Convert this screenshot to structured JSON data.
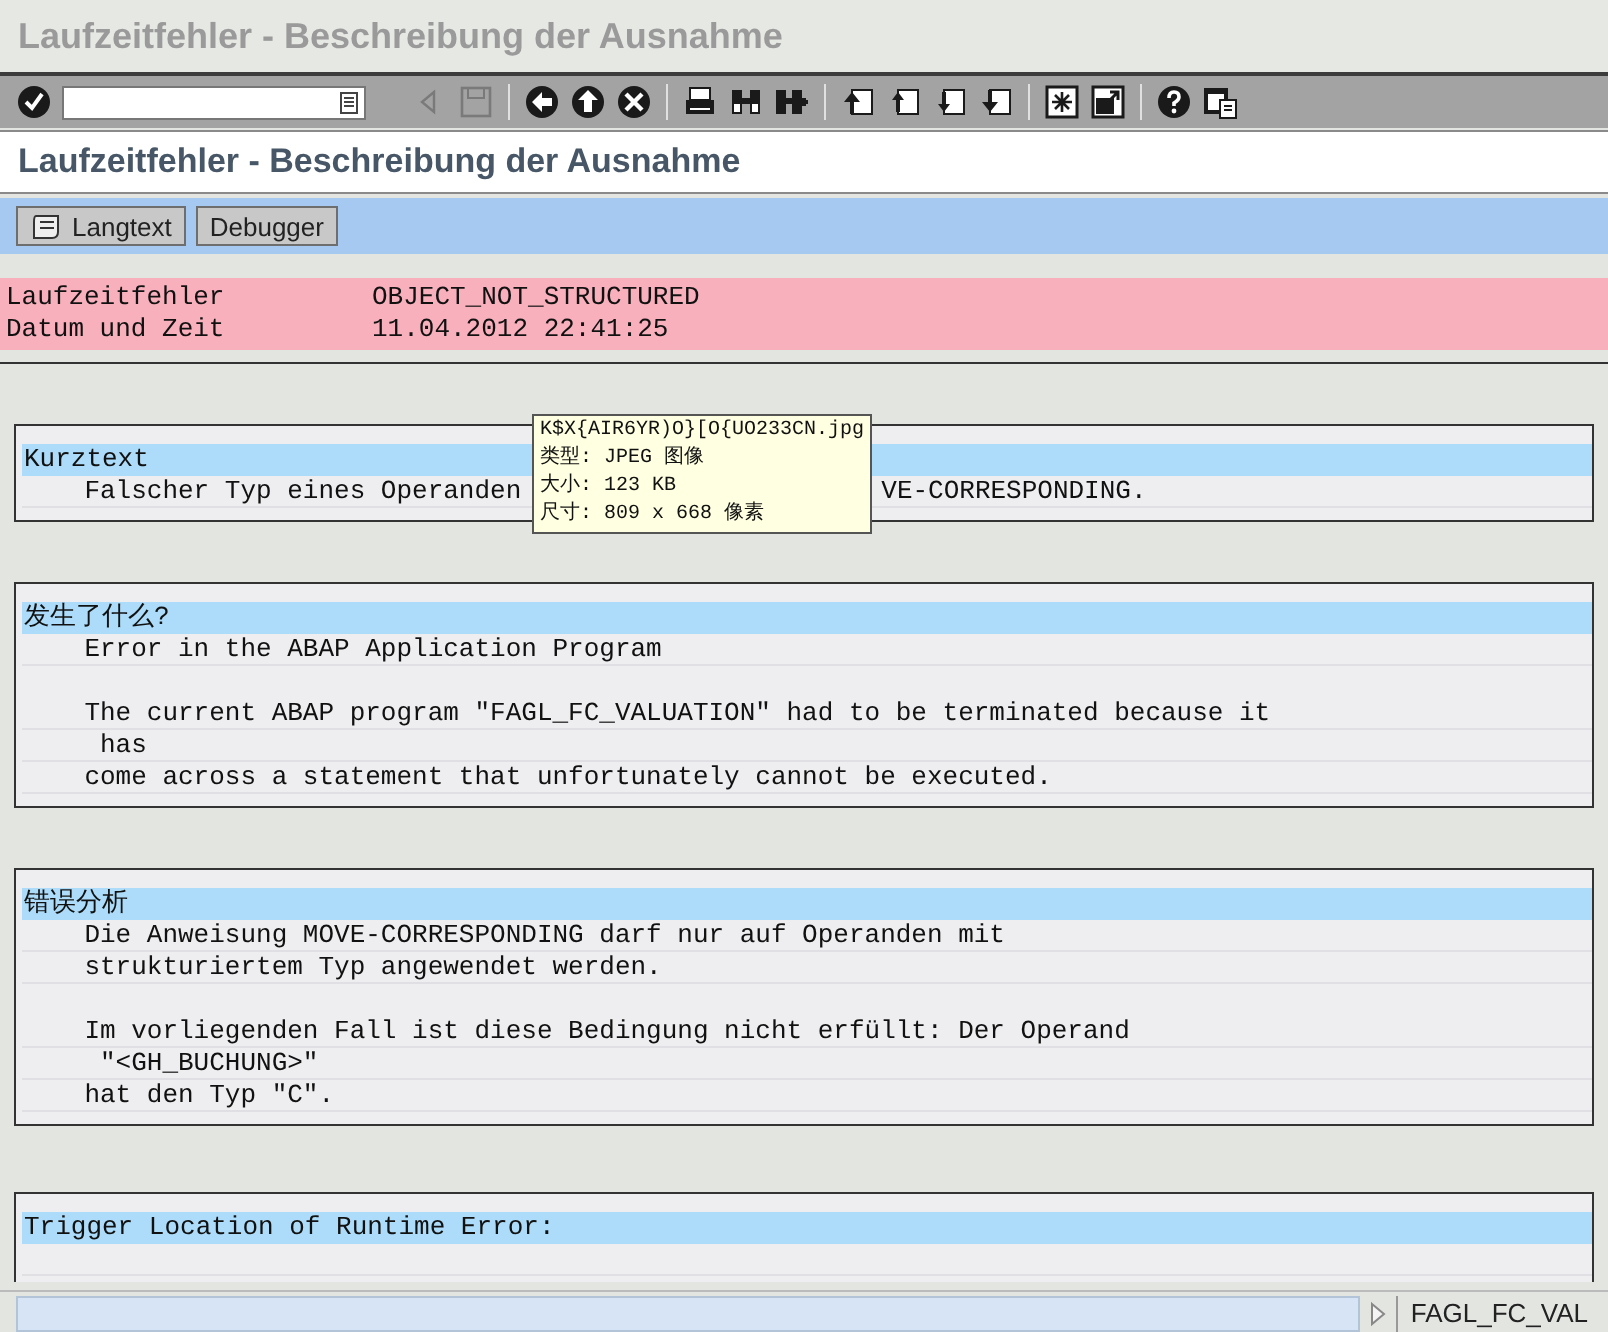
{
  "window": {
    "title": "Laufzeitfehler - Beschreibung der Ausnahme"
  },
  "toolbar": [
    {
      "kind": "check",
      "disabled": false
    },
    {
      "kind": "command-field"
    },
    {
      "kind": "prev",
      "disabled": true
    },
    {
      "kind": "save",
      "disabled": true
    },
    {
      "kind": "separator"
    },
    {
      "kind": "back",
      "disabled": false
    },
    {
      "kind": "exit",
      "disabled": false
    },
    {
      "kind": "cancel",
      "disabled": false
    },
    {
      "kind": "separator"
    },
    {
      "kind": "print",
      "disabled": false
    },
    {
      "kind": "find",
      "disabled": false
    },
    {
      "kind": "find-next",
      "disabled": false
    },
    {
      "kind": "separator"
    },
    {
      "kind": "first-page",
      "disabled": false
    },
    {
      "kind": "prev-page",
      "disabled": false
    },
    {
      "kind": "next-page",
      "disabled": false
    },
    {
      "kind": "last-page",
      "disabled": false
    },
    {
      "kind": "separator"
    },
    {
      "kind": "new-session",
      "disabled": false
    },
    {
      "kind": "shortcut",
      "disabled": false
    },
    {
      "kind": "separator"
    },
    {
      "kind": "help",
      "disabled": false
    },
    {
      "kind": "layout",
      "disabled": false
    }
  ],
  "screen_title": "Laufzeitfehler - Beschreibung der Ausnahme",
  "app_toolbar": [
    {
      "label": "Langtext",
      "kind": "icon-button"
    },
    {
      "label": "Debugger",
      "kind": "button"
    }
  ],
  "header": [
    {
      "label": "Laufzeitfehler",
      "value": "OBJECT_NOT_STRUCTURED"
    },
    {
      "label": "Datum und Zeit",
      "value": "11.04.2012 22:41:25"
    }
  ],
  "sections": [
    {
      "heading": "Kurztext",
      "paragraphs": [
        [
          {
            "text": "Falscher Typ eines Operanden",
            "after_tooltip": "VE-CORRESPONDING."
          }
        ]
      ]
    },
    {
      "heading": "发生了什么?",
      "paragraphs": [
        [
          {
            "text": "Error in the ABAP Application Program"
          }
        ],
        [
          {
            "text": "The current ABAP program \"FAGL_FC_VALUATION\" had to be terminated because it"
          },
          {
            "text": " has"
          },
          {
            "text": "come across a statement that unfortunately cannot be executed."
          }
        ]
      ]
    },
    {
      "heading": "错误分析",
      "paragraphs": [
        [
          {
            "text": "Die Anweisung MOVE-CORRESPONDING darf nur auf Operanden mit"
          },
          {
            "text": "strukturiertem Typ angewendet werden."
          }
        ],
        [
          {
            "text": "Im vorliegenden Fall ist diese Bedingung nicht erfüllt: Der Operand"
          },
          {
            "text": " \"<GH_BUCHUNG>\""
          },
          {
            "text": "hat den Typ \"C\"."
          }
        ]
      ]
    },
    {
      "heading": "Trigger Location of Runtime Error:"
    }
  ],
  "tooltip": {
    "lines": [
      "K$X{AIR6YR)O}[O{UO233CN.jpg",
      "类型: JPEG 图像",
      "大小: 123 KB",
      "尺寸: 809 x 668 像素"
    ]
  },
  "status_bar": {
    "program": "FAGL_FC_VAL"
  }
}
